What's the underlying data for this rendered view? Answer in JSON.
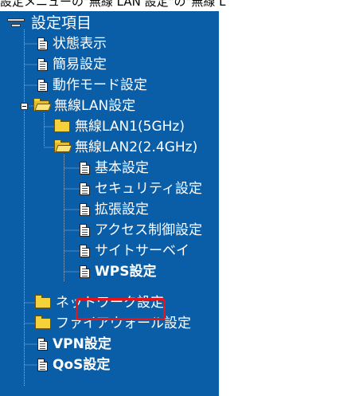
{
  "caption": "設定メニューの\"無線 LAN 設定\"の\"無線 L",
  "tree": {
    "root_label": "設定項目",
    "items": [
      {
        "label": "状態表示",
        "icon": "document-icon"
      },
      {
        "label": "簡易設定",
        "icon": "document-icon"
      },
      {
        "label": "動作モード設定",
        "icon": "document-icon"
      },
      {
        "label": "無線LAN設定",
        "icon": "folder-open-icon",
        "expanded": true
      },
      {
        "label": "無線LAN1(5GHz)",
        "icon": "folder-icon"
      },
      {
        "label": "無線LAN2(2.4GHz)",
        "icon": "folder-open-icon",
        "expanded": true
      },
      {
        "label": "基本設定",
        "icon": "document-icon"
      },
      {
        "label": "セキュリティ設定",
        "icon": "document-icon"
      },
      {
        "label": "拡張設定",
        "icon": "document-icon"
      },
      {
        "label": "アクセス制御設定",
        "icon": "document-icon"
      },
      {
        "label": "サイトサーベイ",
        "icon": "document-icon"
      },
      {
        "label": "WPS設定",
        "icon": "document-icon",
        "highlighted": true
      },
      {
        "label": "ネットワーク設定",
        "icon": "folder-icon"
      },
      {
        "label": "ファイアウォール設定",
        "icon": "folder-icon"
      },
      {
        "label": "VPN設定",
        "icon": "document-icon"
      },
      {
        "label": "QoS設定",
        "icon": "document-icon"
      }
    ]
  },
  "colors": {
    "panel_background": "#0a5ea8",
    "label_text": "#ffffff",
    "highlight_border": "#e5141a",
    "folder": "#f5d13a"
  }
}
